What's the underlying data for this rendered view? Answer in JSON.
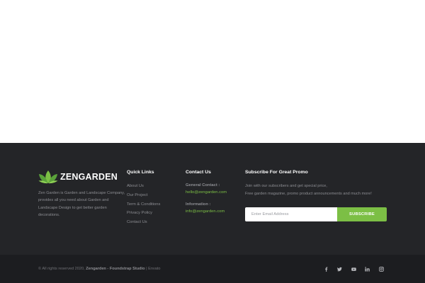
{
  "brand": {
    "name": "ZENGARDEN",
    "about": "Zen Garden is Garden and Landscape Company, provides all you need about Garden and Landscape Design to get better garden decorations.",
    "accent": "#7cbf45"
  },
  "quick_links": {
    "title": "Quick Links",
    "items": [
      {
        "label": "About Us"
      },
      {
        "label": "Our Project"
      },
      {
        "label": "Term & Conditions"
      },
      {
        "label": "Privacy Policy"
      },
      {
        "label": "Contact Us"
      }
    ]
  },
  "contact": {
    "title": "Contact Us",
    "general_label": "General Contact :",
    "general_email": "hello@zengarden.com",
    "info_label": "Information :",
    "info_email": "info@zengarden.com"
  },
  "subscribe": {
    "title": "Subscribe For Great Promo",
    "line1": "Join with our subscribers and get special price,",
    "line2": "Free garden magazine, promo product announcements and much more!",
    "placeholder": "Enter Email Address",
    "button_label": "SUBSCRIBE"
  },
  "copyright": {
    "prefix": "© All rights reserved 2020,",
    "studio": "Zengarden - Foundstrap Studio",
    "separator": "|",
    "vendor": "Envato"
  },
  "socials": [
    {
      "icon": "facebook-icon"
    },
    {
      "icon": "twitter-icon"
    },
    {
      "icon": "youtube-icon"
    },
    {
      "icon": "linkedin-icon"
    },
    {
      "icon": "instagram-icon"
    }
  ],
  "colors": {
    "footer_bg": "#242528",
    "bottom_bar_bg": "#1c1d20",
    "accent": "#7cbf45",
    "muted_text": "#8c8d92"
  }
}
